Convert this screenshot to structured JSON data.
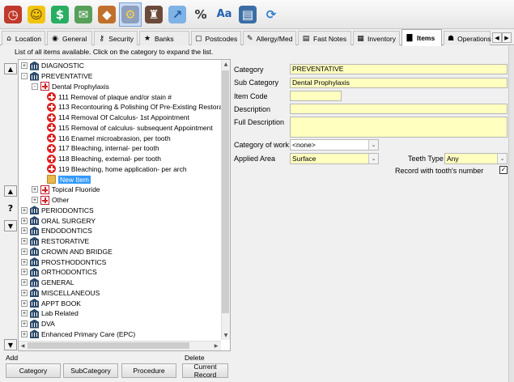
{
  "toolbar": {
    "buttons": [
      {
        "name": "clock-icon",
        "glyph": "◷",
        "bg": "#c0392b",
        "fg": "#fff"
      },
      {
        "name": "smiley-icon",
        "glyph": "☺",
        "bg": "#f1c40f",
        "fg": "#5a3e00"
      },
      {
        "name": "dollar-icon",
        "glyph": "$",
        "bg": "#27ae60",
        "fg": "#fff"
      },
      {
        "name": "mail-icon",
        "glyph": "✉",
        "bg": "#58a05a",
        "fg": "#fff"
      },
      {
        "name": "shield-icon",
        "glyph": "◆",
        "bg": "#c0702b",
        "fg": "#fff"
      },
      {
        "name": "gears-icon",
        "glyph": "⚙",
        "bg": "#8e9fbf",
        "fg": "#f7d04a"
      },
      {
        "name": "teacher-icon",
        "glyph": "♜",
        "bg": "#6b4a3a",
        "fg": "#fff"
      },
      {
        "name": "chart-icon",
        "glyph": "↗",
        "bg": "#7fb2e5",
        "fg": "#1f5fa0"
      },
      {
        "name": "percent-icon",
        "glyph": "%",
        "bg": "transparent",
        "fg": "#333"
      },
      {
        "name": "font-size-icon",
        "glyph": "Aa",
        "bg": "transparent",
        "fg": "#2060b0"
      },
      {
        "name": "document-icon",
        "glyph": "▤",
        "bg": "#3b6ea5",
        "fg": "#fff"
      },
      {
        "name": "refresh-icon",
        "glyph": "⟳",
        "bg": "transparent",
        "fg": "#2e7fd0"
      }
    ]
  },
  "tabs": [
    {
      "label": "Location",
      "glyph": "⌂"
    },
    {
      "label": "General",
      "glyph": "◉"
    },
    {
      "label": "Security",
      "glyph": "⚷"
    },
    {
      "label": "Banks",
      "glyph": "★"
    },
    {
      "label": "Postcodes",
      "glyph": "▢"
    },
    {
      "label": "Allergy/Med",
      "glyph": "✎"
    },
    {
      "label": "Fast Notes",
      "glyph": "▤"
    },
    {
      "label": "Inventory",
      "glyph": "▦"
    },
    {
      "label": "Items",
      "glyph": "▇"
    },
    {
      "label": "Operations",
      "glyph": "☗"
    }
  ],
  "list_caption": "List of all items available. Click on the category to expand the list.",
  "tree": [
    {
      "label": "DIAGNOSTIC",
      "icon": "bank",
      "level": 0,
      "exp": "+"
    },
    {
      "label": "PREVENTATIVE",
      "icon": "bank",
      "level": 0,
      "exp": "-"
    },
    {
      "label": "Dental Prophylaxis",
      "icon": "cat",
      "level": 1,
      "exp": "-"
    },
    {
      "label": "111 Removal of plaque and/or stain #",
      "icon": "item",
      "level": 2
    },
    {
      "label": "113 Recontouring & Polishing Of Pre-Existing Restoratio",
      "icon": "item",
      "level": 2
    },
    {
      "label": "114 Removal Of Calculus- 1st Appointment",
      "icon": "item",
      "level": 2
    },
    {
      "label": "115 Removal of calculus- subsequent Appointment",
      "icon": "item",
      "level": 2
    },
    {
      "label": "116 Enamel microabrasion, per tooth",
      "icon": "item",
      "level": 2
    },
    {
      "label": "117 Bleaching, internal- per tooth",
      "icon": "item",
      "level": 2
    },
    {
      "label": "118 Bleaching, external- per tooth",
      "icon": "item",
      "level": 2
    },
    {
      "label": "119 Bleaching, home application- per arch",
      "icon": "item",
      "level": 2
    },
    {
      "label": "New Item",
      "icon": "folder",
      "level": 2,
      "selected": true
    },
    {
      "label": "Topical Fluoride",
      "icon": "cat",
      "level": 1,
      "exp": "+"
    },
    {
      "label": "Other",
      "icon": "cat",
      "level": 1,
      "exp": "+"
    },
    {
      "label": "PERIODONTICS",
      "icon": "bank",
      "level": 0,
      "exp": "+"
    },
    {
      "label": "ORAL SURGERY",
      "icon": "bank",
      "level": 0,
      "exp": "+"
    },
    {
      "label": "ENDODONTICS",
      "icon": "bank",
      "level": 0,
      "exp": "+"
    },
    {
      "label": "RESTORATIVE",
      "icon": "bank",
      "level": 0,
      "exp": "+"
    },
    {
      "label": "CROWN AND BRIDGE",
      "icon": "bank",
      "level": 0,
      "exp": "+"
    },
    {
      "label": "PROSTHODONTICS",
      "icon": "bank",
      "level": 0,
      "exp": "+"
    },
    {
      "label": "ORTHODONTICS",
      "icon": "bank",
      "level": 0,
      "exp": "+"
    },
    {
      "label": "GENERAL",
      "icon": "bank",
      "level": 0,
      "exp": "+"
    },
    {
      "label": "MISCELLANEOUS",
      "icon": "bank",
      "level": 0,
      "exp": "+"
    },
    {
      "label": "APPT BOOK",
      "icon": "bank",
      "level": 0,
      "exp": "+"
    },
    {
      "label": "Lab Related",
      "icon": "bank",
      "level": 0,
      "exp": "+"
    },
    {
      "label": "DVA",
      "icon": "bank",
      "level": 0,
      "exp": "+"
    },
    {
      "label": "Enhanced Primary Care (EPC)",
      "icon": "bank",
      "level": 0,
      "exp": "+"
    }
  ],
  "bottom": {
    "add_label": "Add",
    "delete_label": "Delete",
    "category_btn": "Category",
    "subcategory_btn": "SubCategory",
    "procedure_btn": "Procedure",
    "current_record_btn": "Current Record"
  },
  "form": {
    "category_label": "Category",
    "category_value": "PREVENTATIVE",
    "subcategory_label": "Sub Category",
    "subcategory_value": "Dental Prophylaxis",
    "item_code_label": "Item Code",
    "item_code_value": "",
    "description_label": "Description",
    "description_value": "",
    "full_description_label": "Full Description",
    "full_description_value": "",
    "category_of_work_label": "Category of work",
    "category_of_work_value": "<none>",
    "applied_area_label": "Applied Area",
    "applied_area_value": "Surface",
    "teeth_type_label": "Teeth Type",
    "teeth_type_value": "Any",
    "record_tooth_label": "Record with tooth's number",
    "record_tooth_checked": true
  }
}
